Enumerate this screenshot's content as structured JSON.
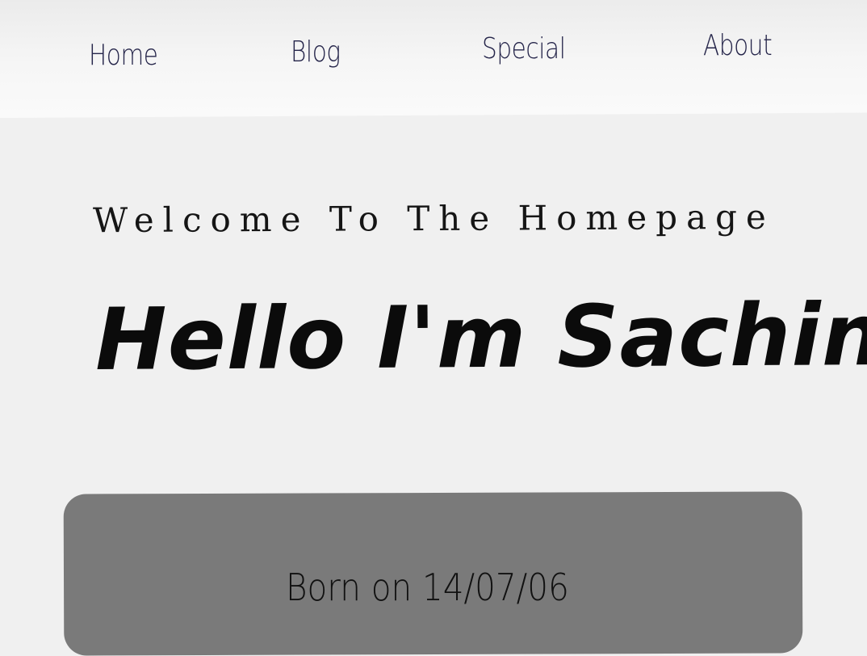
{
  "nav": {
    "items": [
      {
        "label": "Home"
      },
      {
        "label": "Blog"
      },
      {
        "label": "Special"
      },
      {
        "label": "About"
      }
    ]
  },
  "hero": {
    "welcome": "Welcome To The Homepage",
    "title": "Hello I'm Sachin"
  },
  "card": {
    "born": "Born on 14/07/06"
  },
  "colors": {
    "background": "#f0f0f0",
    "nav_text": "#25254a",
    "card": "#7a7a7a",
    "text": "#111111"
  }
}
